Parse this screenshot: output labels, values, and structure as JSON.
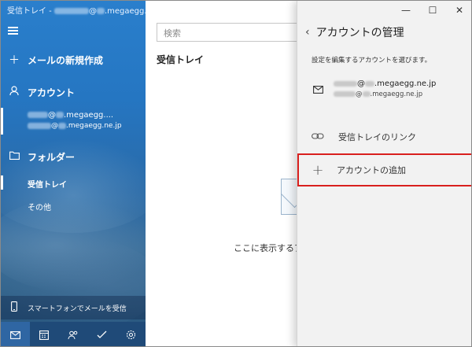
{
  "window": {
    "title_prefix": "受信トレイ - ",
    "title_domain": "@",
    "title_suffix": ".megaegg.ne.jp"
  },
  "sidebar": {
    "new_mail": "メールの新規作成",
    "accounts_header": "アカウント",
    "account_line1_at": "@",
    "account_line1_domain": ".megaegg....",
    "account_line2_at": "@",
    "account_line2_domain": ".megaegg.ne.jp",
    "folders_header": "フォルダー",
    "folders": [
      {
        "label": "受信トレイ",
        "selected": true
      },
      {
        "label": "その他",
        "selected": false
      }
    ],
    "phone_link": "スマートフォンでメールを受信"
  },
  "bottom_icons": [
    "mail-icon",
    "calendar-icon",
    "people-icon",
    "todo-icon",
    "settings-icon"
  ],
  "list": {
    "search_placeholder": "検索",
    "title": "受信トレイ",
    "empty_message": "ここに表示するア"
  },
  "window_controls": {
    "minimize": "—",
    "maximize": "☐",
    "close": "✕"
  },
  "flyout": {
    "back": "‹",
    "title": "アカウントの管理",
    "subtitle": "設定を編集するアカウントを選びます。",
    "account_line1_at": "@",
    "account_line1_domain": ".megaegg.ne.jp",
    "account_line2_at": "@",
    "account_line2_domain": ".megaegg.ne.jp",
    "link_inboxes": "受信トレイのリンク",
    "add_account": "アカウントの追加"
  },
  "colors": {
    "highlight": "#d9201e",
    "sidebar_blue": "#2576c2"
  }
}
